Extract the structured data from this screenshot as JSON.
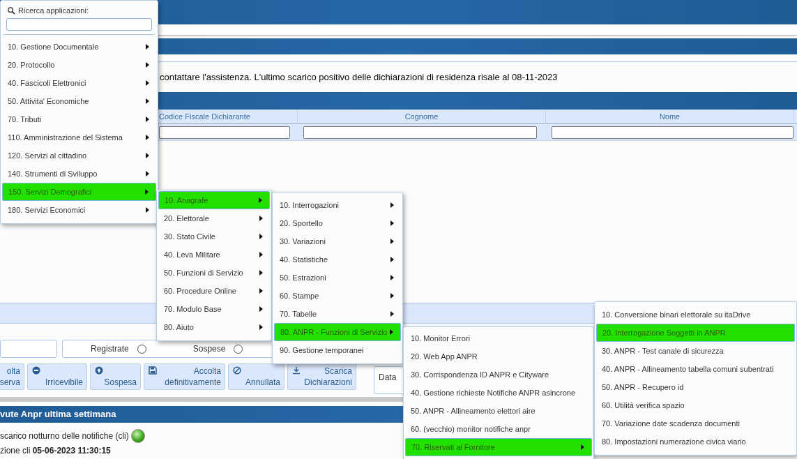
{
  "background": {
    "message": "contattare l'assistenza. L'ultimo scarico positivo delle dichiarazioni di residenza risale al 08-11-2023",
    "table": {
      "columns": [
        "Codice Fiscale Dichiarante",
        "Cognome",
        "Nome"
      ]
    },
    "status_filter": [
      {
        "label": "Registrate",
        "selected": false
      },
      {
        "label": "Sospese",
        "selected": false
      }
    ],
    "actions": [
      {
        "kind": "none",
        "lines": [
          "olta",
          "serva"
        ]
      },
      {
        "kind": "minus",
        "lines": [
          "Irricevibile"
        ]
      },
      {
        "kind": "up",
        "lines": [
          "Sospesa"
        ]
      },
      {
        "kind": "save",
        "lines": [
          "Accolta",
          "definitivamente"
        ]
      },
      {
        "kind": "cancel",
        "lines": [
          "Annullata"
        ]
      },
      {
        "kind": "download",
        "lines": [
          "Scarica",
          "Dichiarazioni"
        ]
      }
    ],
    "date_label": "Data",
    "section_title": "vute Anpr ultima settimana",
    "nightly_label": "scarico notturno delle notifiche (cli)",
    "nightly_ok": true,
    "last_run": "zione cli **05-06-2023 11:30:15**"
  },
  "app_search": {
    "label": "Ricerca applicazioni:"
  },
  "menus": [
    {
      "items": [
        {
          "label": "10. Gestione Documentale",
          "submenu": true,
          "selected": false
        },
        {
          "label": "20. Protocollo",
          "submenu": true,
          "selected": false
        },
        {
          "label": "40. Fascicoli Elettronici",
          "submenu": true,
          "selected": false
        },
        {
          "label": "50. Attivita' Economiche",
          "submenu": true,
          "selected": false
        },
        {
          "label": "70. Tributi",
          "submenu": true,
          "selected": false
        },
        {
          "label": "110. Amministrazione del Sistema",
          "submenu": true,
          "selected": false
        },
        {
          "label": "120. Servizi al cittadino",
          "submenu": true,
          "selected": false
        },
        {
          "label": "140. Strumenti di Sviluppo",
          "submenu": true,
          "selected": false
        },
        {
          "label": "150. Servizi Demografici",
          "submenu": true,
          "selected": true
        },
        {
          "label": "180. Servizi Economici",
          "submenu": true,
          "selected": false
        }
      ]
    },
    {
      "items": [
        {
          "label": "10. Anagrafe",
          "submenu": true,
          "selected": true
        },
        {
          "label": "20. Elettorale",
          "submenu": true,
          "selected": false
        },
        {
          "label": "30. Stato Civile",
          "submenu": true,
          "selected": false
        },
        {
          "label": "40. Leva Militare",
          "submenu": true,
          "selected": false
        },
        {
          "label": "50. Funzioni di Servizio",
          "submenu": true,
          "selected": false
        },
        {
          "label": "60. Procedure Online",
          "submenu": true,
          "selected": false
        },
        {
          "label": "70. Modulo Base",
          "submenu": true,
          "selected": false
        },
        {
          "label": "80. Aiuto",
          "submenu": true,
          "selected": false
        }
      ]
    },
    {
      "items": [
        {
          "label": "10. Interrogazioni",
          "submenu": true,
          "selected": false
        },
        {
          "label": "20. Sportello",
          "submenu": true,
          "selected": false
        },
        {
          "label": "30. Variazioni",
          "submenu": true,
          "selected": false
        },
        {
          "label": "40. Statistiche",
          "submenu": true,
          "selected": false
        },
        {
          "label": "50. Estrazioni",
          "submenu": true,
          "selected": false
        },
        {
          "label": "60. Stampe",
          "submenu": true,
          "selected": false
        },
        {
          "label": "70. Tabelle",
          "submenu": true,
          "selected": false
        },
        {
          "label": "80. ANPR - Funzioni di Servizio",
          "submenu": true,
          "selected": true
        },
        {
          "label": "90. Gestione temporanei",
          "submenu": false,
          "selected": false
        }
      ]
    },
    {
      "items": [
        {
          "label": "10. Monitor Errori",
          "submenu": false,
          "selected": false
        },
        {
          "label": "20. Web App ANPR",
          "submenu": false,
          "selected": false
        },
        {
          "label": "30. Corrispondenza ID ANPR e Cityware",
          "submenu": false,
          "selected": false
        },
        {
          "label": "40. Gestione richieste Notifiche ANPR asincrone",
          "submenu": false,
          "selected": false
        },
        {
          "label": "50. ANPR - Allineamento elettori aire",
          "submenu": false,
          "selected": false
        },
        {
          "label": "60. (vecchio) monitor notifiche anpr",
          "submenu": false,
          "selected": false
        },
        {
          "label": "70. Riservati al Fornitore",
          "submenu": true,
          "selected": true
        }
      ]
    },
    {
      "items": [
        {
          "label": "10. Conversione binari elettorale su itaDrive",
          "submenu": false,
          "selected": false
        },
        {
          "label": "20. Interrogazione Soggetti in ANPR",
          "submenu": false,
          "selected": true
        },
        {
          "label": "30. ANPR - Test canale di sicurezza",
          "submenu": false,
          "selected": false
        },
        {
          "label": "40. ANPR - Allineamento tabella comuni subentrati",
          "submenu": false,
          "selected": false
        },
        {
          "label": "50. ANPR - Recupero id",
          "submenu": false,
          "selected": false
        },
        {
          "label": "60. Utilità verifica spazio",
          "submenu": false,
          "selected": false
        },
        {
          "label": "70. Variazione date scadenza documenti",
          "submenu": false,
          "selected": false
        },
        {
          "label": "80. Impostazioni numerazione civica viario",
          "submenu": false,
          "selected": false
        }
      ]
    }
  ]
}
